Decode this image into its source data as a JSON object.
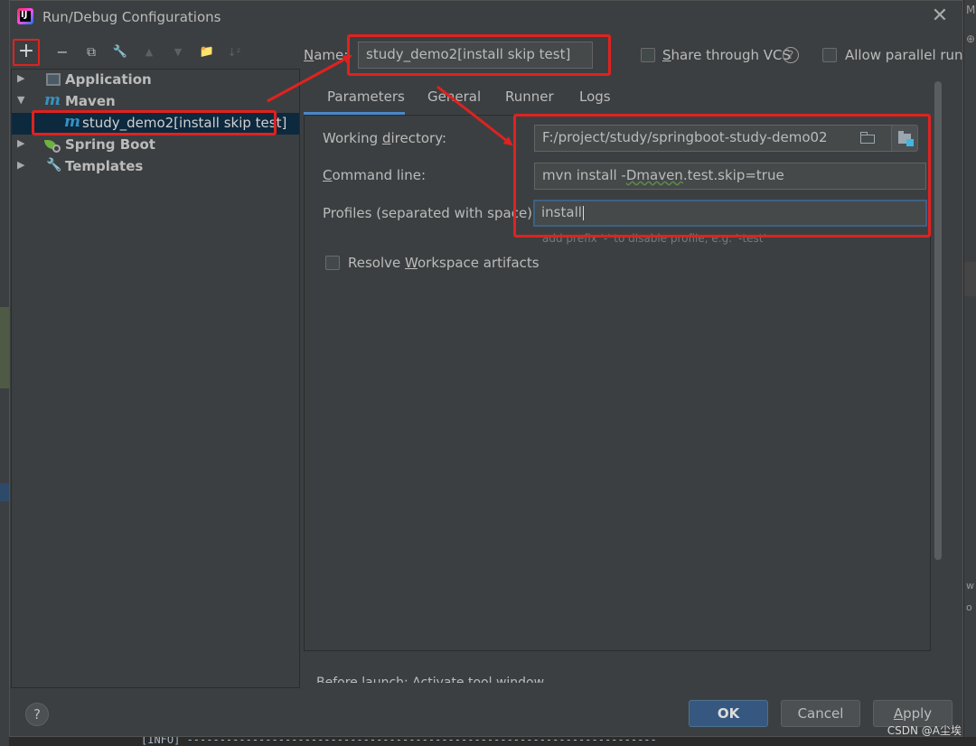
{
  "window": {
    "title": "Run/Debug Configurations",
    "close_symbol": "✕"
  },
  "toolbar": {
    "add": "+",
    "remove": "−",
    "copy": "⧉",
    "edit": "🔧",
    "move_up": "▲",
    "move_down": "▼",
    "folder": "📁",
    "sort": "↓²"
  },
  "tree": {
    "items": [
      {
        "label": "Application",
        "expanded": false,
        "icon": "application-icon"
      },
      {
        "label": "Maven",
        "expanded": true,
        "icon": "maven-icon"
      },
      {
        "label": "study_demo2[install skip test]",
        "selected": true,
        "icon": "maven-icon"
      },
      {
        "label": "Spring Boot",
        "expanded": false,
        "icon": "spring-boot-icon"
      },
      {
        "label": "Templates",
        "expanded": false,
        "icon": "wrench-icon"
      }
    ]
  },
  "name": {
    "label_mnemonic": "N",
    "label_rest": "ame:",
    "value": "study_demo2[install skip test]"
  },
  "options": {
    "share_vcs_mnemonic": "S",
    "share_vcs_rest": "hare through VCS",
    "allow_parallel": "Allow parallel run",
    "help_symbol": "?"
  },
  "tabs": [
    "Parameters",
    "General",
    "Runner",
    "Logs"
  ],
  "parameters": {
    "working_dir_label_pre": "Working ",
    "working_dir_label_mnemonic": "d",
    "working_dir_label_post": "irectory:",
    "working_dir_value": "F:/project/study/springboot-study-demo02",
    "command_line_label_mnemonic": "C",
    "command_line_label_rest": "ommand line:",
    "command_line_pre": "mvn install -",
    "command_line_squiggle": "Dmaven",
    "command_line_post": ".test.skip=true",
    "profiles_label": "Profiles (separated with space):",
    "profiles_value": "install",
    "profiles_hint": "add prefix '-' to disable profile, e.g. '-test'",
    "resolve_pre": "Resolve ",
    "resolve_mnemonic": "W",
    "resolve_post": "orkspace artifacts",
    "before_launch": "Before launch: Activate tool window"
  },
  "footer": {
    "help": "?",
    "ok": "OK",
    "cancel": "Cancel",
    "apply_mnemonic": "A",
    "apply_rest": "pply",
    "watermark": "CSDN @A尘埃"
  },
  "background": {
    "right_text_1": "M",
    "right_text_2": "⊕",
    "right_text_3": "w",
    "right_text_4": "o",
    "console_line": "[INFO] ------------------------------------------------------------------------"
  },
  "colors": {
    "highlight_red": "#e0221f",
    "accent_blue": "#4a88c7",
    "ok_button": "#365880",
    "selection": "#0d293e"
  }
}
